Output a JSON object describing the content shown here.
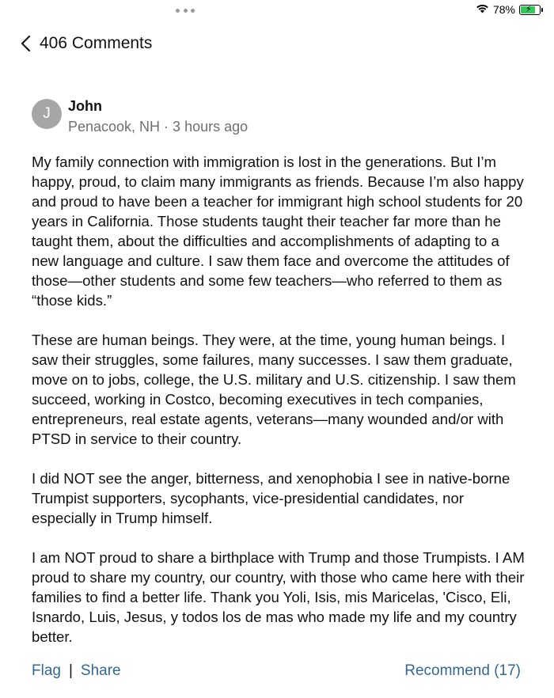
{
  "status_bar": {
    "battery_percent": "78%",
    "battery_level": 0.78,
    "wifi_icon": "wifi-icon",
    "charging_icon": "bolt-icon"
  },
  "header": {
    "back_icon": "chevron-left-icon",
    "title": "406 Comments"
  },
  "comment": {
    "avatar_initial": "J",
    "author": "John",
    "meta": "Penacook, NH · 3 hours ago",
    "paragraphs": [
      "My family connection with immigration is lost in the generations. But I’m happy, proud, to claim many immigrants as friends. Because I’m also happy and proud to have been a teacher for immigrant high school students for 20 years in California. Those students taught their teacher far more than he taught them, about the difficulties and accomplishments of adapting to a new language and culture. I saw them face and overcome the attitudes of those—other students and some few teachers—who referred to them as “those kids.”",
      "These are human beings. They were, at the time, young human beings. I saw their struggles, some failures, many successes. I saw them graduate, move on to jobs, college, the U.S. military and U.S. citizenship. I saw them succeed, working in Costco, becoming executives in tech companies, entrepreneurs, real estate agents, veterans—many wounded and/or with PTSD in service to their country.",
      "I did NOT see the anger, bitterness, and xenophobia I see in native-borne Trumpist supporters, sycophants, vice-presidential candidates, nor especially in Trump himself.",
      "I am NOT proud to share a birthplace with Trump and those Trumpists. I AM proud to share my country, our country, with those who came here with their families to find a better life. Thank you Yoli, Isis, mis Maricelas, 'Cisco, Eli, Isnardo, Luis, Jesus, y todos los de mas who made my life and my country better."
    ],
    "actions": {
      "flag": "Flag",
      "separator": "|",
      "share": "Share",
      "recommend": "Recommend (17)"
    }
  },
  "colors": {
    "link": "#326891",
    "meta": "#6f6f6f",
    "avatar_bg": "#a6a6a6",
    "battery_fill": "#34c759"
  }
}
